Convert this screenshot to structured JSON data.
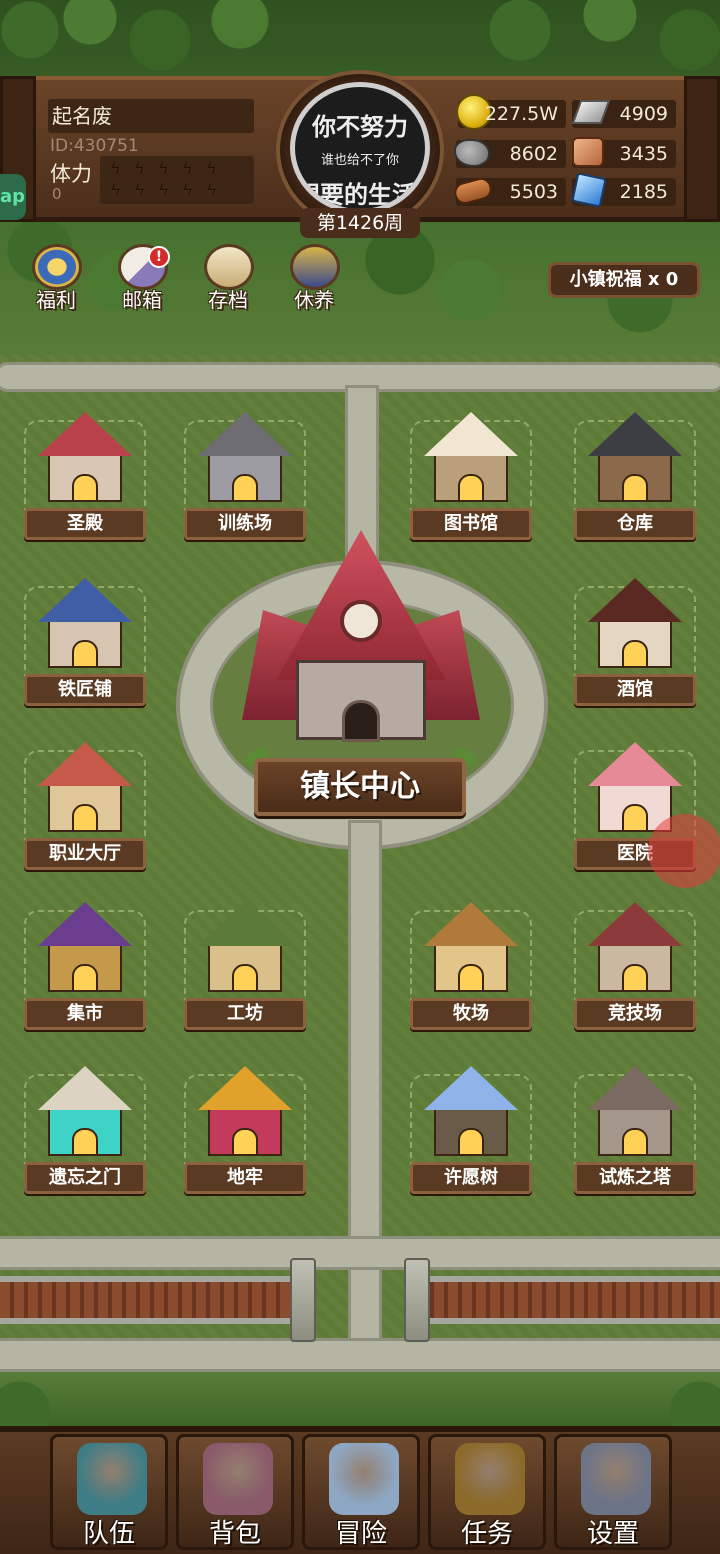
{
  "player": {
    "name": "起名废",
    "id_text": "ID:430751",
    "stamina_label": "体力",
    "stamina_value": "0",
    "stamina_bolts": [
      "ϟ",
      "ϟ",
      "ϟ",
      "ϟ",
      "ϟ",
      "ϟ",
      "ϟ",
      "ϟ",
      "ϟ",
      "ϟ"
    ]
  },
  "week": {
    "banner_line1": "你不努力",
    "banner_line2": "谁也给不了你",
    "banner_line3": "想要的生活",
    "label": "第1426周"
  },
  "resources": [
    {
      "icon": "gold-coin-icon",
      "value": "227.5W"
    },
    {
      "icon": "iron-ingot-icon",
      "value": "4909"
    },
    {
      "icon": "stone-icon",
      "value": "8602"
    },
    {
      "icon": "leather-icon",
      "value": "3435"
    },
    {
      "icon": "wood-log-icon",
      "value": "5503"
    },
    {
      "icon": "crystal-icon",
      "value": "2185"
    }
  ],
  "quick_menu": [
    {
      "label": "福利",
      "icon": "welfare-wheel-icon",
      "badge": ""
    },
    {
      "label": "邮箱",
      "icon": "mail-icon",
      "badge": "!"
    },
    {
      "label": "存档",
      "icon": "save-scroll-icon",
      "badge": ""
    },
    {
      "label": "休养",
      "icon": "rest-scroll-icon",
      "badge": ""
    }
  ],
  "town_blessing": "小镇祝福 x 0",
  "side_tab": "ap",
  "town_center": "镇长中心",
  "buildings": [
    {
      "label": "圣殿",
      "icon": "temple-icon",
      "roof": "#b8414b",
      "wall": "#d9c7b4"
    },
    {
      "label": "训练场",
      "icon": "training-ground-icon",
      "roof": "#6d6d72",
      "wall": "#9c9ca2"
    },
    {
      "label": "图书馆",
      "icon": "library-book-icon",
      "roof": "#f1e6d2",
      "wall": "#b9a07a"
    },
    {
      "label": "仓库",
      "icon": "warehouse-icon",
      "roof": "#3d3d44",
      "wall": "#8a6a4a"
    },
    {
      "label": "铁匠铺",
      "icon": "blacksmith-icon",
      "roof": "#3f5ea6",
      "wall": "#d7c5b2"
    },
    {
      "label": "酒馆",
      "icon": "tavern-icon",
      "roof": "#5a2a22",
      "wall": "#e4d6c0"
    },
    {
      "label": "职业大厅",
      "icon": "job-hall-icon",
      "roof": "#c55a4a",
      "wall": "#e0c79a"
    },
    {
      "label": "医院",
      "icon": "hospital-icon",
      "roof": "#e58a96",
      "wall": "#f1d9d4"
    },
    {
      "label": "集市",
      "icon": "market-tent-icon",
      "roof": "#6a3d8e",
      "wall": "#c49a4a"
    },
    {
      "label": "工坊",
      "icon": "workshop-icon",
      "roof": "#5a7a36",
      "wall": "#d9c08a"
    },
    {
      "label": "牧场",
      "icon": "ranch-icon",
      "roof": "#b07a3a",
      "wall": "#e3c58a"
    },
    {
      "label": "竞技场",
      "icon": "arena-colosseum-icon",
      "roof": "#8c3a3a",
      "wall": "#cbb8a0"
    },
    {
      "label": "遗忘之门",
      "icon": "forgotten-portal-icon",
      "roof": "#dcd3c2",
      "wall": "#3fd3c7"
    },
    {
      "label": "地牢",
      "icon": "dungeon-flame-icon",
      "roof": "#e0a22a",
      "wall": "#c43a5a"
    },
    {
      "label": "许愿树",
      "icon": "wishing-tree-icon",
      "roof": "#8fb2e8",
      "wall": "#6a5a48"
    },
    {
      "label": "试炼之塔",
      "icon": "trial-tower-icon",
      "roof": "#7a6a62",
      "wall": "#a5968c"
    }
  ],
  "nav": [
    {
      "label": "队伍",
      "icon": "helmet-icon",
      "color": "#3d7d86"
    },
    {
      "label": "背包",
      "icon": "backpack-icon",
      "color": "#8a5a6a"
    },
    {
      "label": "冒险",
      "icon": "crossed-swords-icon",
      "color": "#8ea7c4"
    },
    {
      "label": "任务",
      "icon": "quest-scroll-icon",
      "color": "#8c6a2a"
    },
    {
      "label": "设置",
      "icon": "gear-icon",
      "color": "#6c7488"
    }
  ]
}
